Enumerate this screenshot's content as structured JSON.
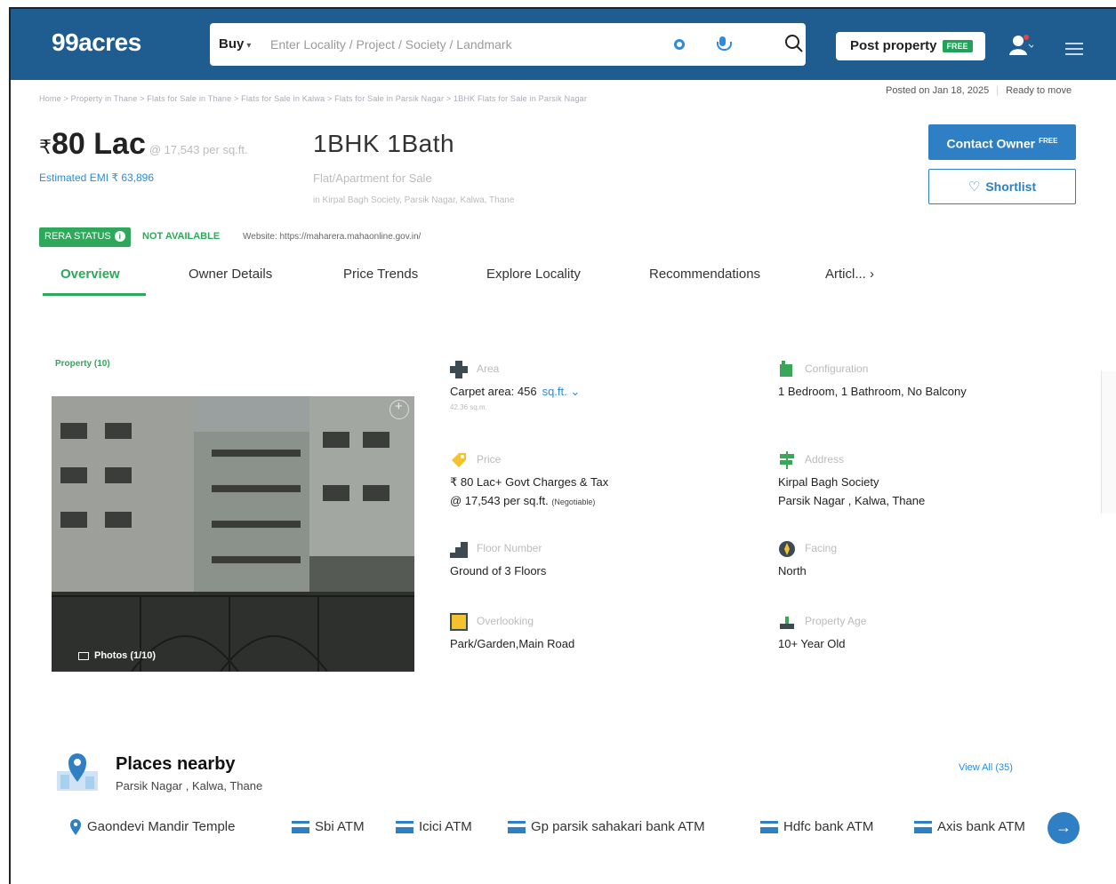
{
  "header": {
    "logo": "99acres",
    "search_mode": "Buy",
    "search_placeholder": "Enter Locality / Project / Society / Landmark",
    "post_property_label": "Post property",
    "post_property_badge": "FREE"
  },
  "breadcrumb": "Home > Property in Thane > Flats for Sale in Thane > Flats for Sale in Kalwa > Flats for Sale in Parsik Nagar > 1BHK Flats for Sale in Parsik Nagar",
  "listing_meta": {
    "posted": "Posted on Jan 18, 2025",
    "status": "Ready to move"
  },
  "summary": {
    "rupee": "₹",
    "price": "80 Lac",
    "price_per_sqft": "@ 17,543 per sq.ft.",
    "emi": "Estimated EMI ₹ 63,896",
    "title": "1BHK 1Bath",
    "subtitle": "Flat/Apartment for Sale",
    "address_short": "in Kirpal Bagh Society, Parsik Nagar, Kalwa, Thane"
  },
  "actions": {
    "contact_owner": "Contact Owner",
    "contact_badge": "FREE",
    "shortlist": "Shortlist"
  },
  "rera": {
    "label": "RERA STATUS",
    "status": "NOT AVAILABLE",
    "website": "Website: https://maharera.mahaonline.gov.in/"
  },
  "tabs": [
    "Overview",
    "Owner Details",
    "Price Trends",
    "Explore Locality",
    "Recommendations",
    "Articl..."
  ],
  "property": {
    "label": "Property (10)",
    "photos": "Photos (1/10)"
  },
  "details": {
    "area": {
      "label": "Area",
      "value": "Carpet area: 456",
      "unit": "sq.ft.",
      "sub": "42.36 sq.m."
    },
    "configuration": {
      "label": "Configuration",
      "value": "1 Bedroom, 1 Bathroom, No Balcony"
    },
    "price": {
      "label": "Price",
      "value1": "₹ 80 Lac+ Govt Charges & Tax",
      "value2": "@ 17,543 per sq.ft.",
      "negotiable": "(Negotiable)"
    },
    "address": {
      "label": "Address",
      "value1": "Kirpal Bagh Society",
      "value2": "Parsik Nagar , Kalwa, Thane"
    },
    "floor": {
      "label": "Floor Number",
      "value": "Ground of 3 Floors"
    },
    "facing": {
      "label": "Facing",
      "value": "North"
    },
    "overlooking": {
      "label": "Overlooking",
      "value": "Park/Garden,Main Road"
    },
    "age": {
      "label": "Property Age",
      "value": "10+ Year Old"
    }
  },
  "places": {
    "title": "Places nearby",
    "subtitle": "Parsik Nagar , Kalwa, Thane",
    "view_all": "View All (35)",
    "items": [
      "Gaondevi Mandir Temple",
      "Sbi ATM",
      "Icici ATM",
      "Gp parsik sahakari bank ATM",
      "Hdfc bank ATM",
      "Axis bank ATM"
    ]
  },
  "colors": {
    "header_bg": "#1f5d91",
    "accent_blue": "#2e7fc4",
    "accent_green": "#2ea85a"
  }
}
